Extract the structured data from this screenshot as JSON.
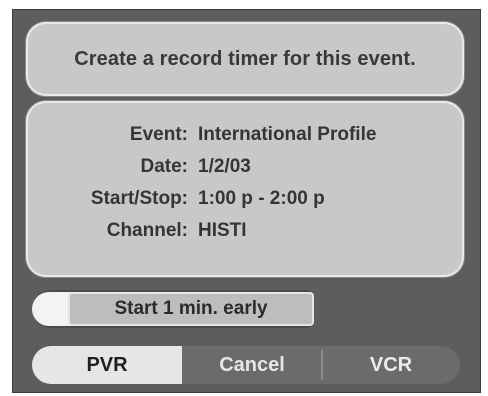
{
  "dialog": {
    "header": "Create a record timer for this event.",
    "details": [
      {
        "label": "Event:",
        "value": "International Profile"
      },
      {
        "label": "Date:",
        "value": "1/2/03"
      },
      {
        "label": "Start/Stop:",
        "value": "1:00 p - 2:00 p"
      },
      {
        "label": "Channel:",
        "value": "HISTI"
      }
    ],
    "start_early_option": "Start 1 min. early",
    "buttons": {
      "pvr": "PVR",
      "cancel": "Cancel",
      "vcr": "VCR"
    },
    "selected_button": "PVR"
  },
  "colors": {
    "background": "#5d5d5d",
    "panel": "#c8c8c8",
    "selected": "#e6e6e6"
  }
}
